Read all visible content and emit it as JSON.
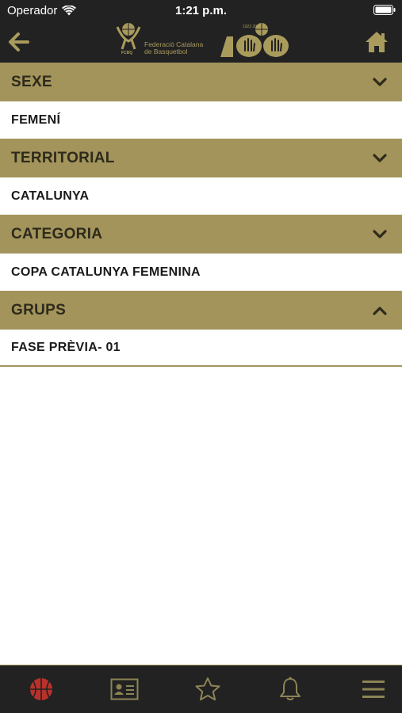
{
  "status_bar": {
    "carrier": "Operador",
    "time": "1:21 p.m."
  },
  "nav": {
    "logo": {
      "org_name": "Federació Catalana\nde Basquetbol",
      "abbr": "FCBQ",
      "years": "1923  2023"
    }
  },
  "filters": [
    {
      "header": "SEXE",
      "value": "FEMENÍ",
      "expanded": false
    },
    {
      "header": "TERRITORIAL",
      "value": "CATALUNYA",
      "expanded": false
    },
    {
      "header": "CATEGORIA",
      "value": "COPA CATALUNYA FEMENINA",
      "expanded": false
    },
    {
      "header": "GRUPS",
      "value": "FASE PRÈVIA- 01",
      "expanded": true
    }
  ],
  "tabbar": {
    "tabs": [
      {
        "icon": "basketball-icon",
        "active": true
      },
      {
        "icon": "id-card-icon",
        "active": false
      },
      {
        "icon": "star-icon",
        "active": false
      },
      {
        "icon": "bell-icon",
        "active": false
      },
      {
        "icon": "menu-icon",
        "active": false
      }
    ]
  },
  "colors": {
    "header_bg": "#222222",
    "accent_gold": "#a2945b",
    "active_tab": "#b8322b",
    "inactive_tab": "#8c8454"
  }
}
